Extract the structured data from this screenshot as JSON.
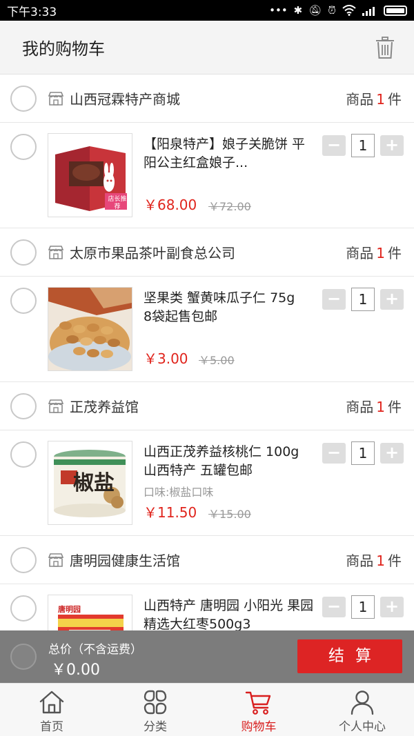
{
  "status_bar": {
    "time": "下午3:33"
  },
  "header": {
    "title": "我的购物车"
  },
  "cart_groups": [
    {
      "shop_name": "山西冠霖特产商城",
      "count_prefix": "商品",
      "count": "1",
      "count_suffix": "件",
      "item": {
        "title": "【阳泉特产】娘子关脆饼 平阳公主红盒娘子...",
        "option": "",
        "price": "￥68.00",
        "original_price": "￥72.00",
        "quantity": "1",
        "thumb_badge": "店长推荐"
      }
    },
    {
      "shop_name": "太原市果品茶叶副食总公司",
      "count_prefix": "商品",
      "count": "1",
      "count_suffix": "件",
      "item": {
        "title": " 坚果类 蟹黄味瓜子仁 75g　8袋起售包邮",
        "option": "",
        "price": "￥3.00",
        "original_price": "￥5.00",
        "quantity": "1"
      }
    },
    {
      "shop_name": "正茂养益馆",
      "count_prefix": "商品",
      "count": "1",
      "count_suffix": "件",
      "item": {
        "title": "山西正茂养益核桃仁 100g 山西特产 五罐包邮",
        "option": "口味:椒盐口味",
        "price": "￥11.50",
        "original_price": "￥15.00",
        "quantity": "1",
        "thumb_label": "椒盐"
      }
    },
    {
      "shop_name": "唐明园健康生活馆",
      "count_prefix": "商品",
      "count": "1",
      "count_suffix": "件",
      "item": {
        "title": "山西特产 唐明园 小阳光 果园精选大红枣500g3",
        "option": "",
        "price": "",
        "original_price": "",
        "quantity": "1",
        "thumb_brand": "唐明园"
      }
    }
  ],
  "stepper": {
    "minus": "−",
    "plus": "+"
  },
  "footer": {
    "total_label": "总价（不含运费）",
    "total_amount": "￥0.00",
    "checkout_label": "结算"
  },
  "tabs": [
    {
      "label": "首页",
      "icon": "home-icon",
      "active": false
    },
    {
      "label": "分类",
      "icon": "category-icon",
      "active": false
    },
    {
      "label": "购物车",
      "icon": "cart-icon",
      "active": true
    },
    {
      "label": "个人中心",
      "icon": "person-icon",
      "active": false
    }
  ],
  "colors": {
    "accent": "#dd2424",
    "price": "#e0241c",
    "footer_bg": "#737373"
  }
}
